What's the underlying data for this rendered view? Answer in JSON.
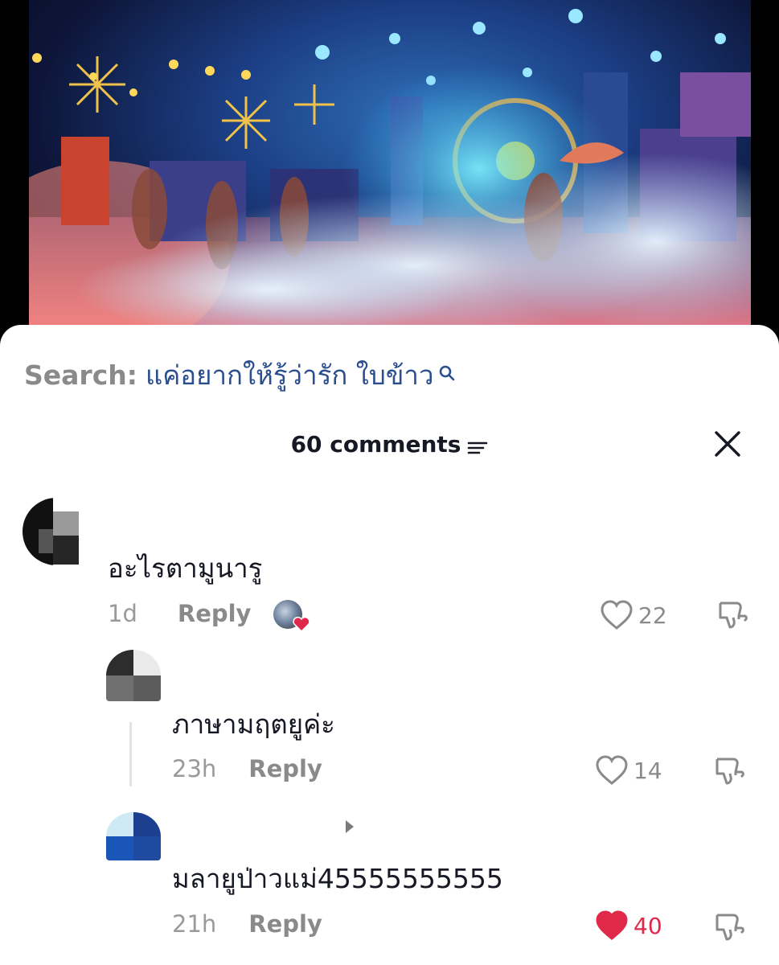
{
  "search": {
    "prefix": "Search:",
    "query": "แค่อยากให้รู้ว่ารัก ใบข้าว"
  },
  "header": {
    "comments_count": "60 comments"
  },
  "comments": [
    {
      "text": "อะไรตามูนารู",
      "time": "1d",
      "reply_label": "Reply",
      "likes": "22",
      "liked": false,
      "creator_liked": true
    },
    {
      "text": "ภาษามฤตยูค่ะ",
      "time": "23h",
      "reply_label": "Reply",
      "likes": "14",
      "liked": false
    },
    {
      "text": "มลายูป่าวแม่45555555555",
      "time": "21h",
      "reply_label": "Reply",
      "likes": "40",
      "liked": true
    }
  ],
  "colors": {
    "like_active": "#e0294a",
    "search_query": "#2b4f8e",
    "muted": "#8a8a8a"
  },
  "icons": [
    "search-icon",
    "filter-icon",
    "close-icon",
    "heart-icon",
    "dislike-icon"
  ]
}
